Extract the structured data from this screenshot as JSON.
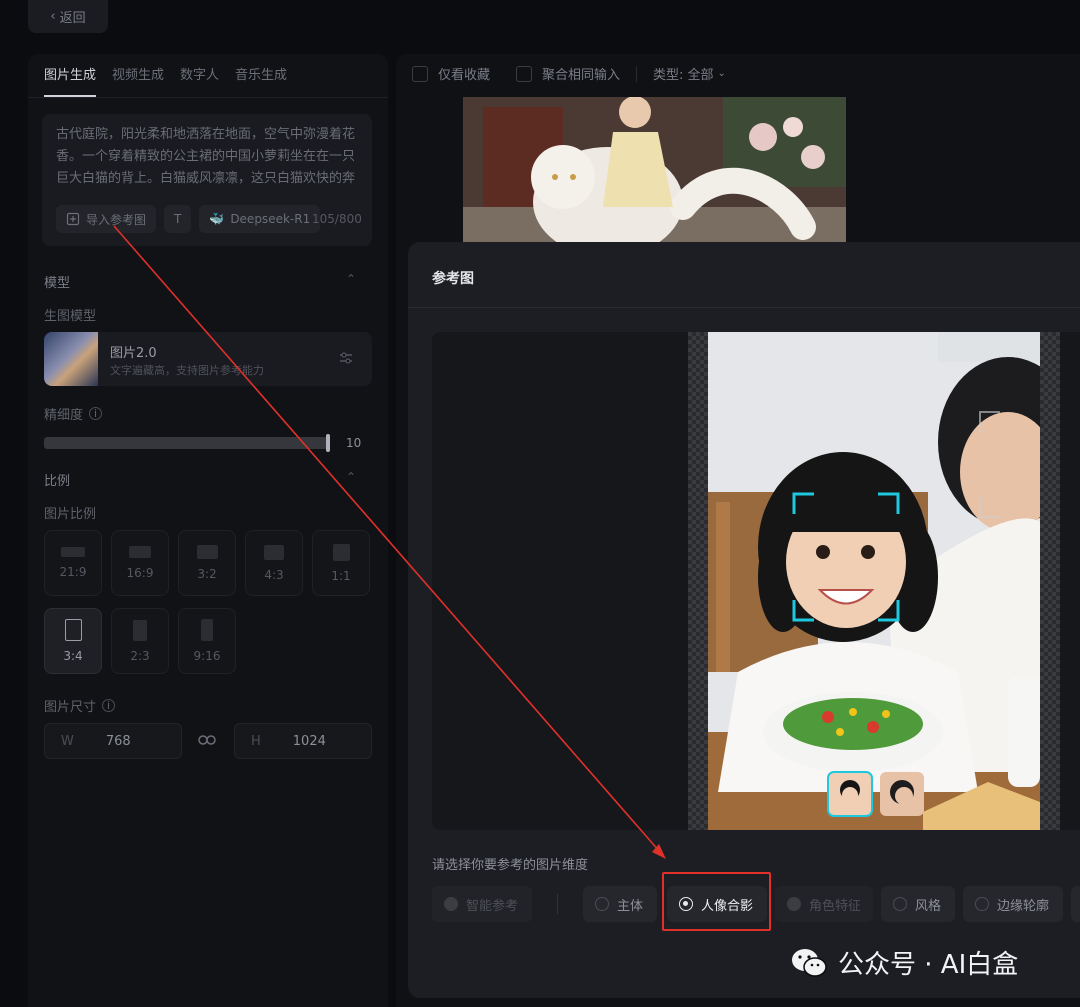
{
  "topbar": {
    "back_label": "返回"
  },
  "left": {
    "tabs": [
      {
        "label": "图片生成",
        "active": true
      },
      {
        "label": "视频生成",
        "active": false
      },
      {
        "label": "数字人",
        "active": false
      },
      {
        "label": "音乐生成",
        "active": false
      }
    ],
    "prompt": {
      "text": "古代庭院，阳光柔和地洒落在地面，空气中弥漫着花香。一个穿着精致的公主裙的中国小萝莉坐在在一只巨大白猫的背上。白猫威风凛凛，这只白猫欢快的奔跑着，孩童可爱的毛发散发着温暖，阳迪",
      "import_ref_label": "导入参考图",
      "text_tool_label": "T",
      "model_chip_label": "Deepseek-R1",
      "counter": "105/800"
    },
    "model_section": {
      "title": "模型",
      "sub_title": "生图模型",
      "model_name": "图片2.0",
      "model_desc": "文字遍藏高，支持图片参考能力"
    },
    "fineness": {
      "label": "精细度",
      "value": "10",
      "fraction": 1.0
    },
    "ratio_section": {
      "title": "比例",
      "sub_title": "图片比例",
      "ratios": [
        {
          "label": "21:9",
          "selected": false
        },
        {
          "label": "16:9",
          "selected": false
        },
        {
          "label": "3:2",
          "selected": false
        },
        {
          "label": "4:3",
          "selected": false
        },
        {
          "label": "1:1",
          "selected": false
        },
        {
          "label": "3:4",
          "selected": true
        },
        {
          "label": "2:3",
          "selected": false
        },
        {
          "label": "9:16",
          "selected": false
        }
      ]
    },
    "size": {
      "label": "图片尺寸",
      "w_label": "W",
      "w_value": "768",
      "h_label": "H",
      "h_value": "1024"
    }
  },
  "right": {
    "filters": {
      "fav_only": "仅看收藏",
      "merge_same": "聚合相同输入",
      "type_label": "类型: 全部"
    }
  },
  "modal": {
    "title": "参考图",
    "choose_label": "请选择你要参考的图片维度",
    "options": [
      {
        "label": "智能参考",
        "state": "disabled"
      },
      {
        "label": "主体",
        "state": "normal"
      },
      {
        "label": "人像合影",
        "state": "selected"
      },
      {
        "label": "角色特征",
        "state": "disabled"
      },
      {
        "label": "风格",
        "state": "normal"
      },
      {
        "label": "边缘轮廓",
        "state": "normal"
      }
    ]
  },
  "watermark": {
    "text": "公众号 · AI白盒"
  },
  "colors": {
    "accent_red": "#e0302a",
    "face_frame": "#1ec8e0"
  }
}
